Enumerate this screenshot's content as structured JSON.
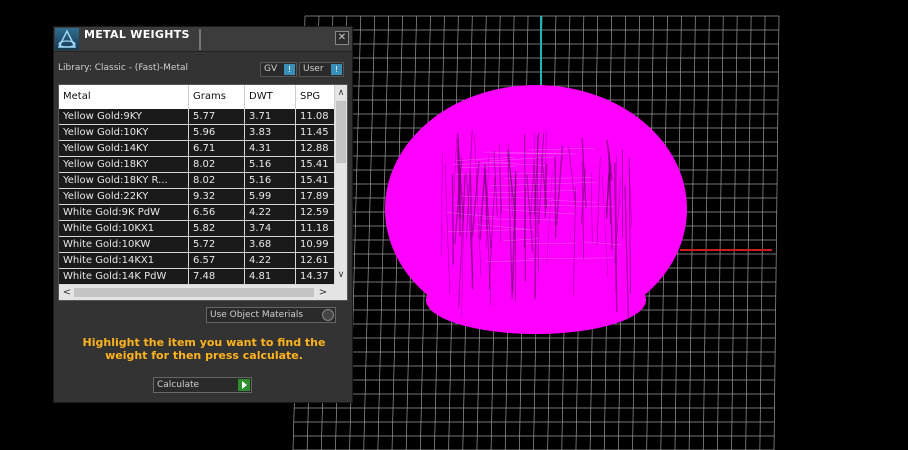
{
  "panel": {
    "title": "METAL WEIGHTS",
    "close_label": "✕",
    "library_label": "Library: Classic - (Fast)-Metal",
    "gv_label": "GV",
    "user_label": "User",
    "toggle_indicator": "!",
    "columns": [
      "Metal",
      "Grams",
      "DWT",
      "SPG"
    ],
    "rows": [
      {
        "metal": "Yellow Gold:9KY",
        "grams": "5.77",
        "dwt": "3.71",
        "spg": "11.08"
      },
      {
        "metal": "Yellow Gold:10KY",
        "grams": "5.96",
        "dwt": "3.83",
        "spg": "11.45"
      },
      {
        "metal": "Yellow Gold:14KY",
        "grams": "6.71",
        "dwt": "4.31",
        "spg": "12.88"
      },
      {
        "metal": "Yellow Gold:18KY",
        "grams": "8.02",
        "dwt": "5.16",
        "spg": "15.41"
      },
      {
        "metal": "Yellow Gold:18KY R...",
        "grams": "8.02",
        "dwt": "5.16",
        "spg": "15.41"
      },
      {
        "metal": "Yellow Gold:22KY",
        "grams": "9.32",
        "dwt": "5.99",
        "spg": "17.89"
      },
      {
        "metal": "White Gold:9K PdW",
        "grams": "6.56",
        "dwt": "4.22",
        "spg": "12.59"
      },
      {
        "metal": "White Gold:10KX1",
        "grams": "5.82",
        "dwt": "3.74",
        "spg": "11.18"
      },
      {
        "metal": "White Gold:10KW",
        "grams": "5.72",
        "dwt": "3.68",
        "spg": "10.99"
      },
      {
        "metal": "White Gold:14KX1",
        "grams": "6.57",
        "dwt": "4.22",
        "spg": "12.61"
      },
      {
        "metal": "White Gold:14K PdW",
        "grams": "7.48",
        "dwt": "4.81",
        "spg": "14.37"
      }
    ],
    "scroll_up": "∧",
    "scroll_down": "∨",
    "scroll_left": "<",
    "scroll_right": ">",
    "use_object_materials_label": "Use Object Materials",
    "instructions": "Highlight the item you want to find the weight for then press calculate.",
    "calculate_label": "Calculate"
  },
  "colors": {
    "object": "#ff00ff",
    "grid": "#9a9a9a",
    "axis_y": "#1fb5b5",
    "axis_x": "#c81e1e",
    "instruction_text": "#ffb41e",
    "panel_bg": "#333333",
    "indicator": "#3a8fb8"
  },
  "icons": {
    "logo": "app-logo-icon",
    "close": "close-icon",
    "go": "play-arrow-icon"
  }
}
